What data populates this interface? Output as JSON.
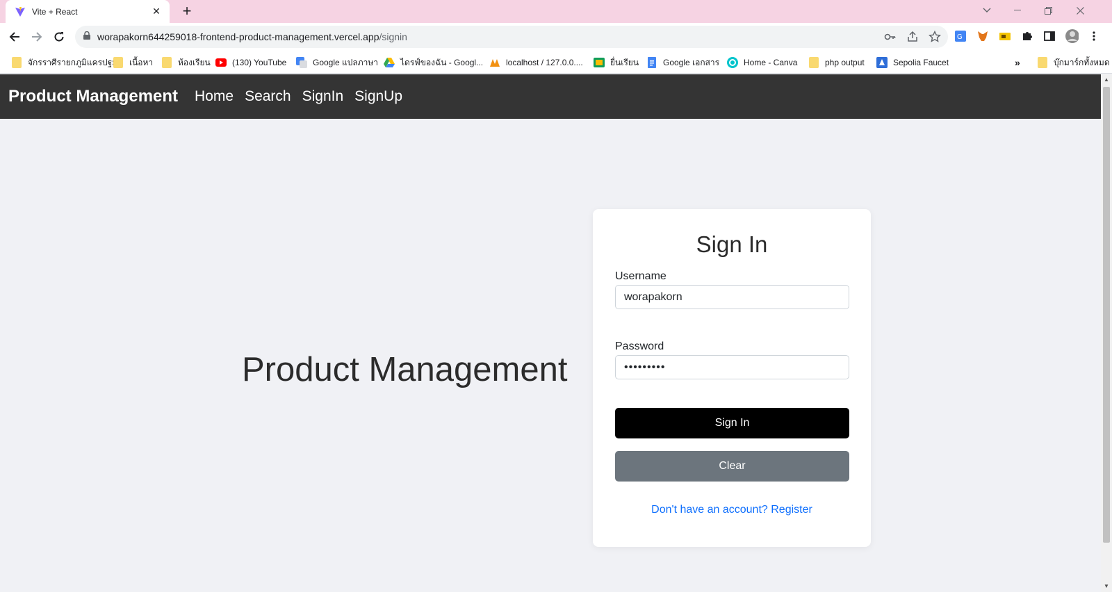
{
  "browser": {
    "tab_title": "Vite + React",
    "url_host": "worapakorn644259018-frontend-product-management.vercel.app",
    "url_path": "/signin",
    "bookmarks": [
      {
        "label": "จักรราศีรายกภูมิแครปฐม",
        "icon": "folder-icon"
      },
      {
        "label": "เนื้อหา",
        "icon": "folder-icon"
      },
      {
        "label": "ห้องเรียน",
        "icon": "folder-icon"
      },
      {
        "label": "(130) YouTube",
        "icon": "youtube-icon"
      },
      {
        "label": "Google แปลภาษา",
        "icon": "google-translate-icon"
      },
      {
        "label": "ไดรฟ์ของฉัน - Googl...",
        "icon": "google-drive-icon"
      },
      {
        "label": "localhost / 127.0.0....",
        "icon": "phpmyadmin-icon"
      },
      {
        "label": "ยื่นเรียน",
        "icon": "classroom-icon"
      },
      {
        "label": "Google เอกสาร",
        "icon": "google-docs-icon"
      },
      {
        "label": "Home - Canva",
        "icon": "canva-icon"
      },
      {
        "label": "php output",
        "icon": "folder-icon"
      },
      {
        "label": "Sepolia Faucet",
        "icon": "sepolia-icon"
      }
    ],
    "more_bookmarks": "»",
    "all_bookmarks": "บุ๊กมาร์กทั้งหมด"
  },
  "navbar": {
    "brand": "Product Management",
    "links": [
      "Home",
      "Search",
      "SignIn",
      "SignUp"
    ]
  },
  "hero_title": "Product Management",
  "signin": {
    "title": "Sign In",
    "username_label": "Username",
    "username_value": "worapakorn",
    "password_label": "Password",
    "password_masked": "•••••••••",
    "signin_button": "Sign In",
    "clear_button": "Clear",
    "register_link": "Don't have an account? Register"
  },
  "colors": {
    "tabbar": "#f6d3e3",
    "navbar": "#343434",
    "page_bg": "#f0f1f5",
    "primary_button": "#000000",
    "secondary_button": "#6c757d",
    "link": "#0d6efd"
  }
}
